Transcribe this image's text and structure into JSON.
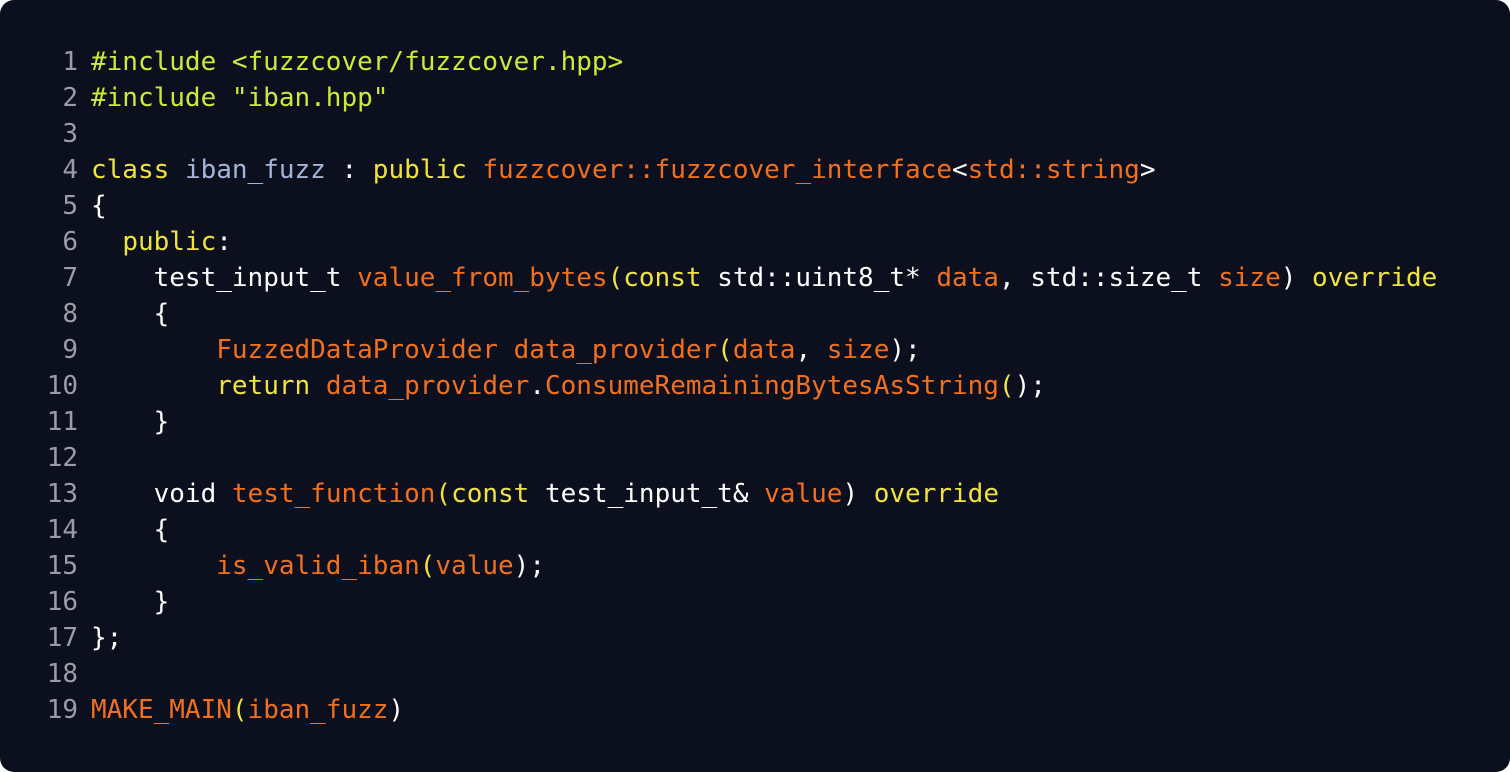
{
  "editor": {
    "colors": {
      "background": "#0b0f1e",
      "line_number": "#9a9ca6",
      "preprocessor": "#cdea3a",
      "keyword": "#f0e33f",
      "function": "#f0701e",
      "class_name": "#a3b6da",
      "plain": "#ffffff"
    },
    "lines": [
      {
        "number": "1",
        "indent": "",
        "tokens": [
          {
            "t": "#include <fuzzcover/fuzzcover.hpp>",
            "k": "pre"
          }
        ]
      },
      {
        "number": "2",
        "indent": "",
        "tokens": [
          {
            "t": "#include \"iban.hpp\"",
            "k": "pre"
          }
        ]
      },
      {
        "number": "3",
        "indent": "",
        "tokens": []
      },
      {
        "number": "4",
        "indent": "",
        "tokens": [
          {
            "t": "class",
            "k": "kw"
          },
          {
            "t": " ",
            "k": "plain"
          },
          {
            "t": "iban_fuzz",
            "k": "type"
          },
          {
            "t": " : ",
            "k": "plain"
          },
          {
            "t": "public",
            "k": "kw"
          },
          {
            "t": " ",
            "k": "plain"
          },
          {
            "t": "fuzzcover::fuzzcover_interface",
            "k": "fn"
          },
          {
            "t": "<",
            "k": "plain"
          },
          {
            "t": "std::string",
            "k": "fn"
          },
          {
            "t": ">",
            "k": "plain"
          }
        ]
      },
      {
        "number": "5",
        "indent": "",
        "tokens": [
          {
            "t": "{",
            "k": "plain"
          }
        ]
      },
      {
        "number": "6",
        "indent": "  ",
        "tokens": [
          {
            "t": "public",
            "k": "kw"
          },
          {
            "t": ":",
            "k": "plain"
          }
        ]
      },
      {
        "number": "7",
        "indent": "    ",
        "tokens": [
          {
            "t": "test_input_t",
            "k": "plain"
          },
          {
            "t": " ",
            "k": "plain"
          },
          {
            "t": "value_from_bytes",
            "k": "fn"
          },
          {
            "t": "(",
            "k": "kw"
          },
          {
            "t": "const",
            "k": "kw"
          },
          {
            "t": " std::uint8_t* ",
            "k": "plain"
          },
          {
            "t": "data",
            "k": "fn"
          },
          {
            "t": ", std::size_t ",
            "k": "plain"
          },
          {
            "t": "size",
            "k": "fn"
          },
          {
            "t": ") ",
            "k": "plain"
          },
          {
            "t": "override",
            "k": "kw"
          }
        ]
      },
      {
        "number": "8",
        "indent": "    ",
        "tokens": [
          {
            "t": "{",
            "k": "plain"
          }
        ]
      },
      {
        "number": "9",
        "indent": "        ",
        "tokens": [
          {
            "t": "FuzzedDataProvider",
            "k": "fn"
          },
          {
            "t": " ",
            "k": "plain"
          },
          {
            "t": "data_provider",
            "k": "fn"
          },
          {
            "t": "(",
            "k": "kw"
          },
          {
            "t": "data",
            "k": "fn"
          },
          {
            "t": ", ",
            "k": "plain"
          },
          {
            "t": "size",
            "k": "fn"
          },
          {
            "t": ");",
            "k": "plain"
          }
        ]
      },
      {
        "number": "10",
        "indent": "        ",
        "tokens": [
          {
            "t": "return",
            "k": "kw"
          },
          {
            "t": " ",
            "k": "plain"
          },
          {
            "t": "data_provider",
            "k": "fn"
          },
          {
            "t": ".",
            "k": "plain"
          },
          {
            "t": "ConsumeRemainingBytesAsString",
            "k": "fn"
          },
          {
            "t": "(",
            "k": "kw"
          },
          {
            "t": ");",
            "k": "plain"
          }
        ]
      },
      {
        "number": "11",
        "indent": "    ",
        "tokens": [
          {
            "t": "}",
            "k": "plain"
          }
        ]
      },
      {
        "number": "12",
        "indent": "",
        "tokens": []
      },
      {
        "number": "13",
        "indent": "    ",
        "tokens": [
          {
            "t": "void",
            "k": "plain"
          },
          {
            "t": " ",
            "k": "plain"
          },
          {
            "t": "test_function",
            "k": "fn"
          },
          {
            "t": "(",
            "k": "kw"
          },
          {
            "t": "const",
            "k": "kw"
          },
          {
            "t": " test_input_t& ",
            "k": "plain"
          },
          {
            "t": "value",
            "k": "fn"
          },
          {
            "t": ") ",
            "k": "plain"
          },
          {
            "t": "override",
            "k": "kw"
          }
        ]
      },
      {
        "number": "14",
        "indent": "    ",
        "tokens": [
          {
            "t": "{",
            "k": "plain"
          }
        ]
      },
      {
        "number": "15",
        "indent": "        ",
        "tokens": [
          {
            "t": "is_valid_iban",
            "k": "fn"
          },
          {
            "t": "(",
            "k": "kw"
          },
          {
            "t": "value",
            "k": "fn"
          },
          {
            "t": ");",
            "k": "plain"
          }
        ]
      },
      {
        "number": "16",
        "indent": "    ",
        "tokens": [
          {
            "t": "}",
            "k": "plain"
          }
        ]
      },
      {
        "number": "17",
        "indent": "",
        "tokens": [
          {
            "t": "};",
            "k": "plain"
          }
        ]
      },
      {
        "number": "18",
        "indent": "",
        "tokens": []
      },
      {
        "number": "19",
        "indent": "",
        "tokens": [
          {
            "t": "MAKE_MAIN",
            "k": "fn"
          },
          {
            "t": "(",
            "k": "kw"
          },
          {
            "t": "iban_fuzz",
            "k": "fn"
          },
          {
            "t": ")",
            "k": "plain"
          }
        ]
      }
    ]
  }
}
